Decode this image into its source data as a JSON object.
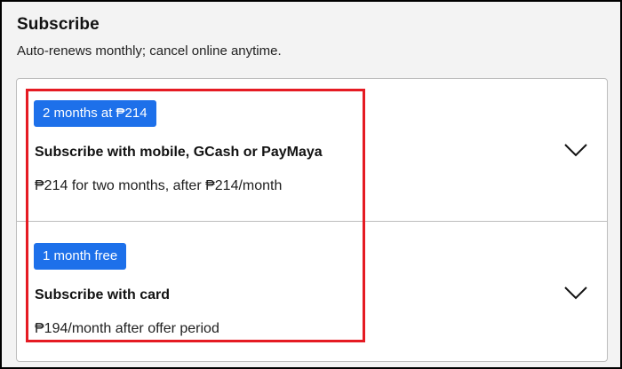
{
  "header": {
    "title": "Subscribe",
    "subtitle": "Auto-renews monthly; cancel online anytime."
  },
  "options": [
    {
      "badge": "2 months at ₱214",
      "title": "Subscribe with mobile, GCash or PayMaya",
      "description": "₱214 for two months, after ₱214/month",
      "icon": "chevron-down-icon"
    },
    {
      "badge": "1 month free",
      "title": "Subscribe with card",
      "description": "₱194/month after offer period",
      "icon": "chevron-down-icon"
    }
  ],
  "colors": {
    "badge": "#1d70ea",
    "highlight": "#e51b23",
    "page_background": "#f3f3f3",
    "card_background": "#ffffff"
  }
}
